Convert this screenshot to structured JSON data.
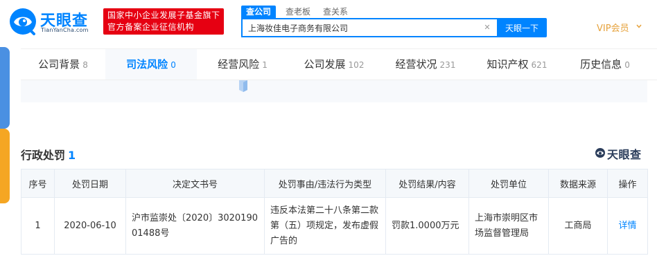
{
  "header": {
    "logo_name": "天眼查",
    "logo_domain": "TianYanCha.com",
    "slogan_line1": "国家中小企业发展子基金旗下",
    "slogan_line2": "官方备案企业征信机构",
    "search_tabs": [
      "查公司",
      "查老板",
      "查关系"
    ],
    "search_value": "上海妆佳电子商务有限公司",
    "search_button": "天眼一下",
    "vip_label": "VIP会员",
    "colors": {
      "brand_blue": "#0084ff",
      "slogan_red": "#e60012",
      "vip_gold": "#e6a23c"
    }
  },
  "nav": {
    "tabs": [
      {
        "label": "公司背景",
        "count": "8"
      },
      {
        "label": "司法风险",
        "count": "0"
      },
      {
        "label": "经营风险",
        "count": "1"
      },
      {
        "label": "公司发展",
        "count": "102"
      },
      {
        "label": "经营状况",
        "count": "231"
      },
      {
        "label": "知识产权",
        "count": "621"
      },
      {
        "label": "历史信息",
        "count": "0"
      }
    ],
    "active_index": 1
  },
  "section": {
    "title": "行政处罚",
    "count": "1",
    "brand_mark": "天眼查"
  },
  "table": {
    "columns": [
      "序号",
      "处罚日期",
      "决定文书号",
      "处罚事由/违法行为类型",
      "处罚结果/内容",
      "处罚单位",
      "数据来源",
      "操作"
    ],
    "rows": [
      {
        "index": "1",
        "date": "2020-06-10",
        "doc_number": "沪市监崇处〔2020〕302019001488号",
        "reason": "违反本法第二十八条第二款第（五）项规定，发布虚假广告的",
        "result": "罚款1.0000万元",
        "authority": "上海市崇明区市场监督管理局",
        "source": "工商局",
        "action": "详情"
      }
    ]
  },
  "icons": [
    "tianyancha-logo-icon",
    "clear-icon",
    "chevron-down-icon",
    "tianyancha-brand-icon"
  ]
}
